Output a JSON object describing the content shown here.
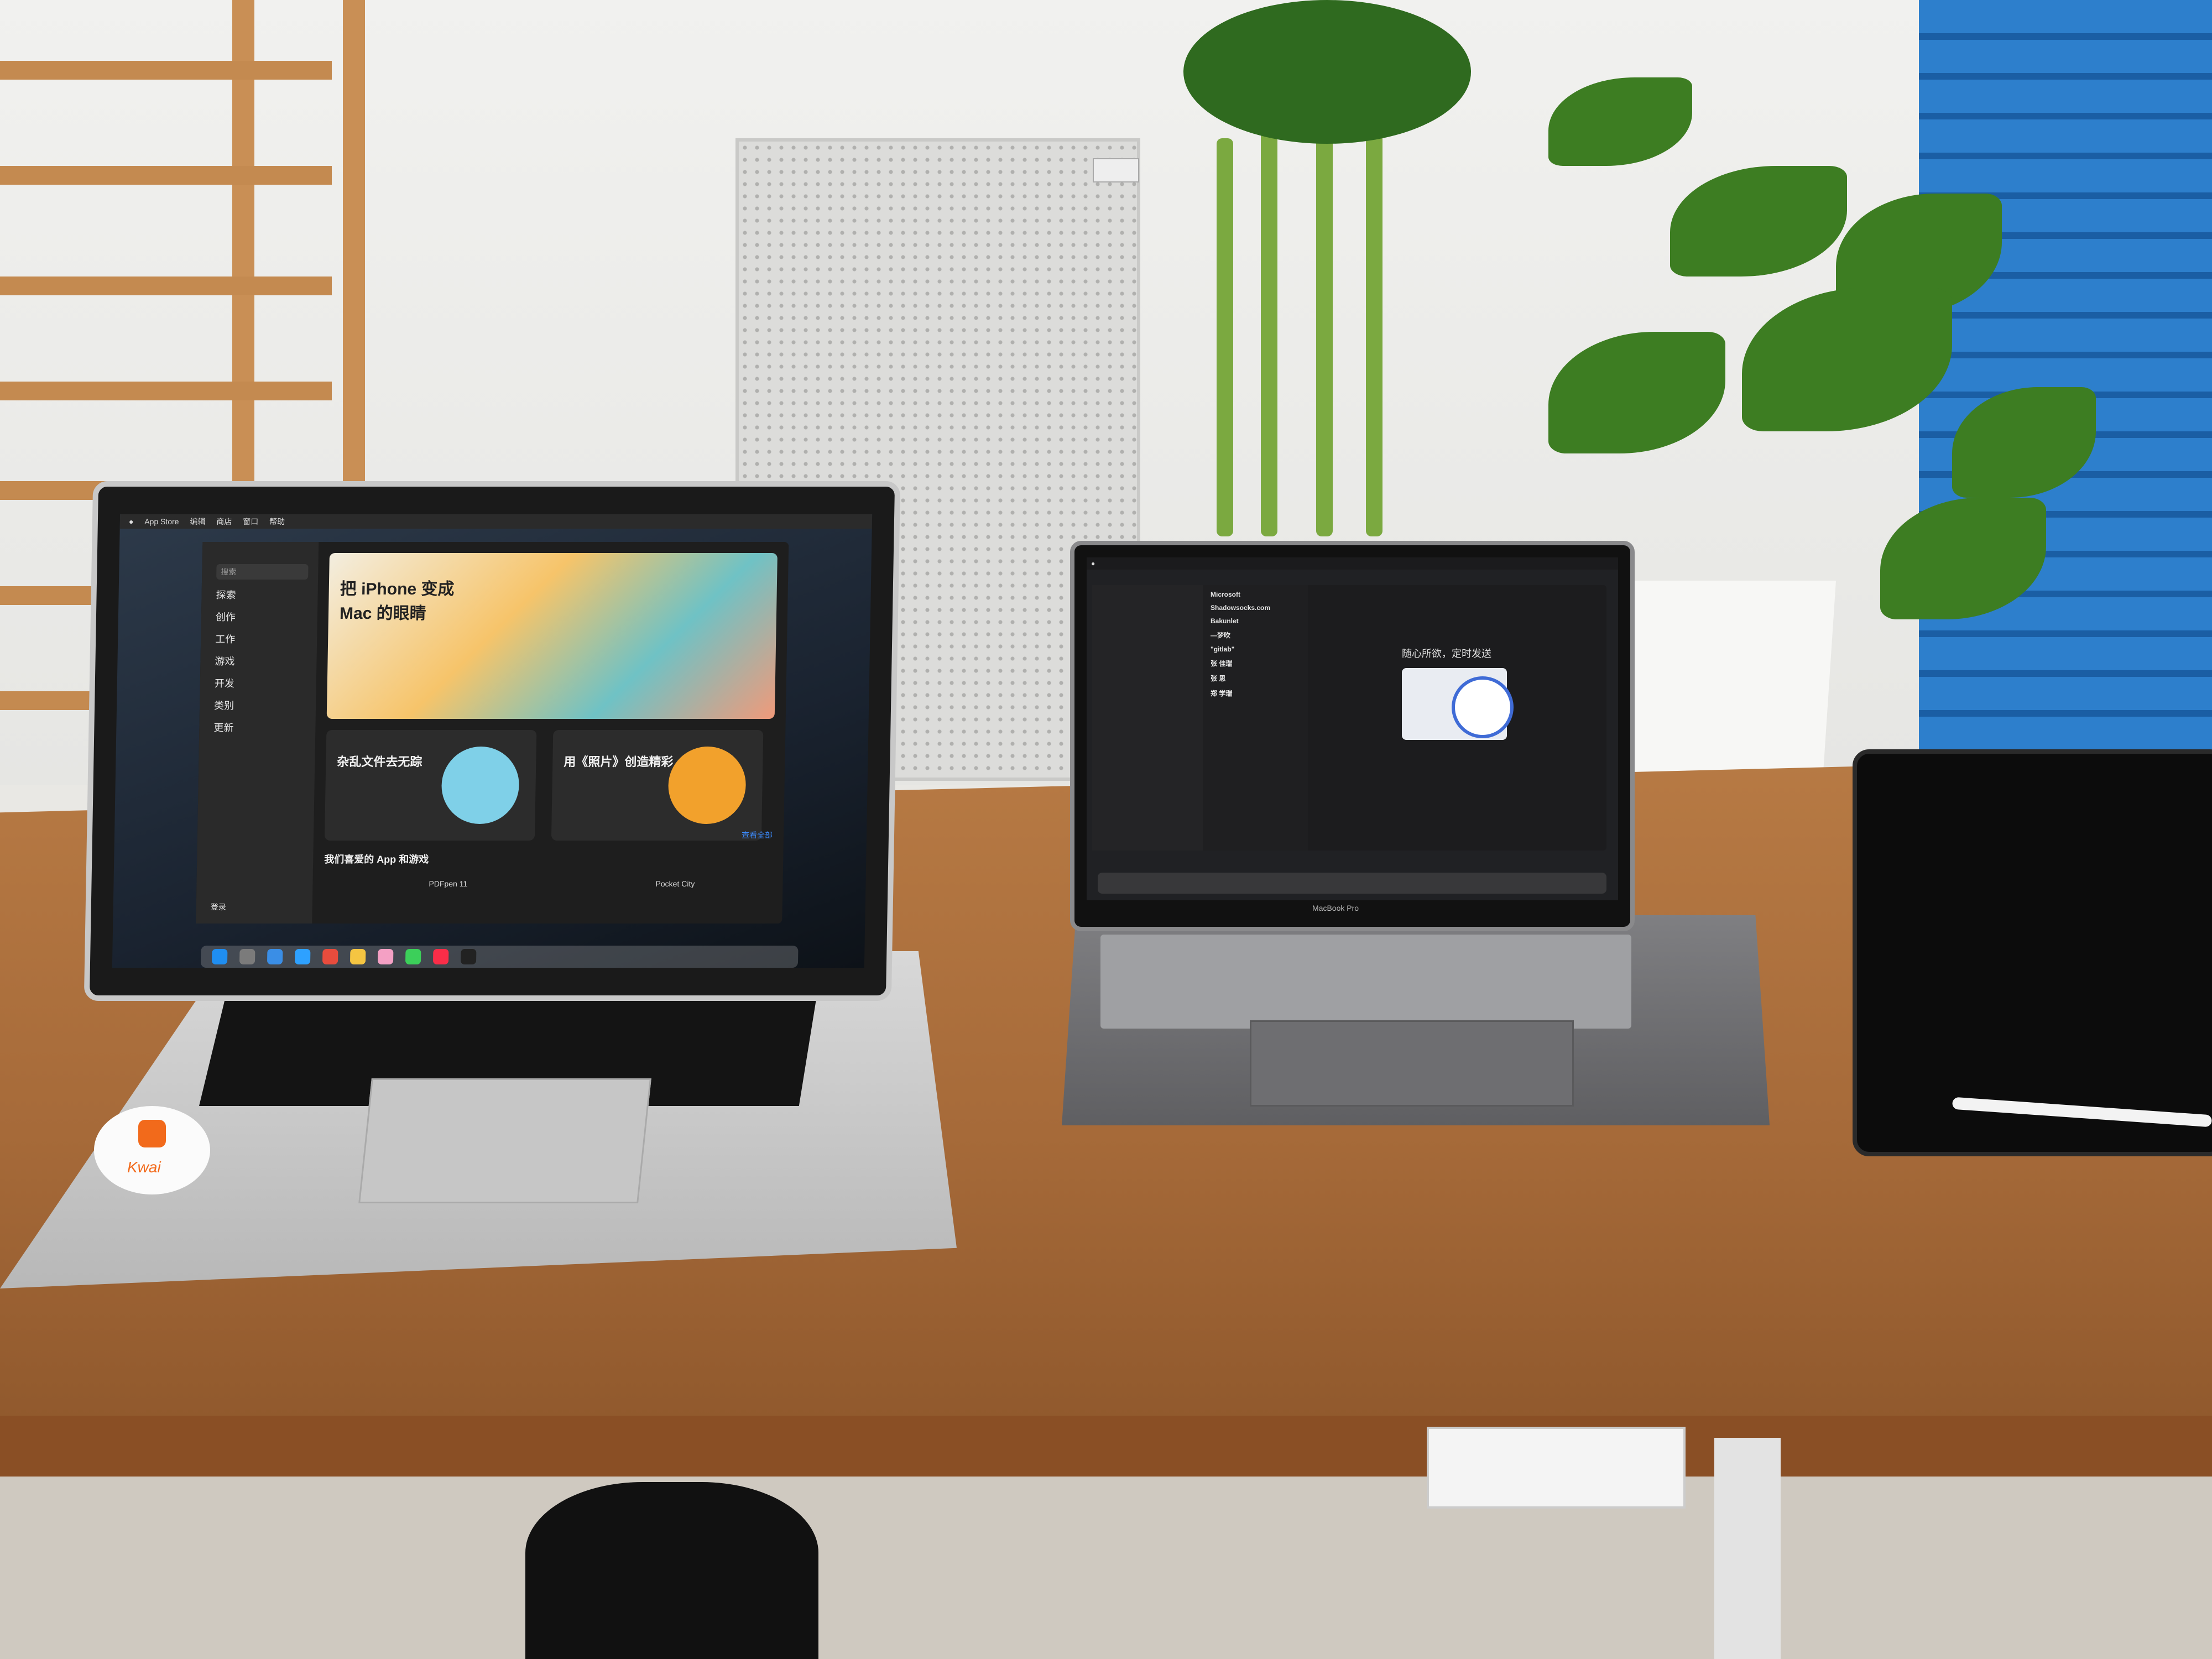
{
  "left_laptop": {
    "menubar": [
      "App Store",
      "编辑",
      "商店",
      "窗口",
      "帮助"
    ],
    "app_store": {
      "search_placeholder": "搜索",
      "sidebar": [
        "探索",
        "创作",
        "工作",
        "游戏",
        "开发",
        "类别",
        "更新"
      ],
      "account": "登录",
      "hero_title": "把 iPhone 变成 Mac 的眼睛",
      "cards": [
        {
          "title": "杂乱文件去无踪"
        },
        {
          "title": "用《照片》创造精彩"
        }
      ],
      "section_title": "我们喜爱的 App 和游戏",
      "see_all": "查看全部",
      "apps": [
        "PDFpen 11",
        "Pocket City"
      ]
    },
    "sticker_text": "Kwai"
  },
  "right_laptop": {
    "brand": "MacBook Pro",
    "mail_list": [
      "Microsoft",
      "Shadowsocks.com",
      "Bakunlet",
      "—梦吹",
      "\"gitlab\"",
      "张 佳瑞",
      "张 思",
      "郑 学瑞"
    ],
    "empty_state": "随心所欲，定时发送"
  }
}
